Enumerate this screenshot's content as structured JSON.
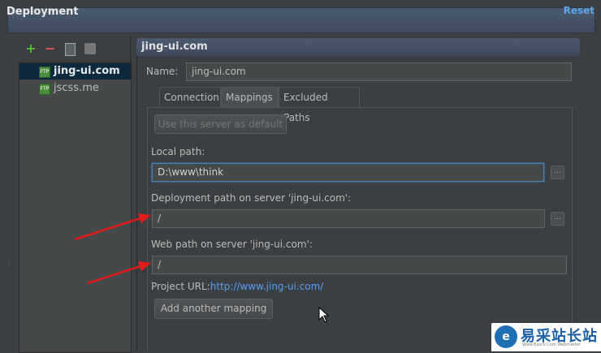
{
  "header": {
    "title": "Deployment",
    "reset_label": "Reset"
  },
  "toolbar": {
    "add_symbol": "+",
    "remove_symbol": "−",
    "icons": [
      "add-icon",
      "remove-icon",
      "copy-icon",
      "server-icon"
    ]
  },
  "servers": [
    {
      "label": "jing-ui.com",
      "selected": true,
      "icon": "ftp-server-icon"
    },
    {
      "label": "jscss.me",
      "selected": false,
      "icon": "ftp-server-icon"
    }
  ],
  "panel": {
    "title": "jing-ui.com",
    "name_label": "Name:",
    "name_value": "jing-ui.com",
    "tabs": [
      "Connection",
      "Mappings",
      "Excluded Paths"
    ],
    "active_tab": "Mappings",
    "default_button": "Use this server as default",
    "local_path_label": "Local path:",
    "local_path_value": "D:\\www\\think",
    "deployment_path_label": "Deployment path on server 'jing-ui.com':",
    "deployment_path_value": "/",
    "web_path_label": "Web path on server 'jing-ui.com':",
    "web_path_value": "/",
    "project_url_label": "Project URL:",
    "project_url_value": "http://www.jing-ui.com/",
    "add_mapping_button": "Add another mapping",
    "browse_symbol": "..."
  },
  "watermark": {
    "logo_text": "e",
    "title": "易采站长站",
    "subtitle": "Www.Easck.Com Webmaster"
  },
  "colors": {
    "accent": "#589df6",
    "selection": "#0d293e",
    "arrow": "#e01c1c",
    "background": "#3c3f41"
  }
}
